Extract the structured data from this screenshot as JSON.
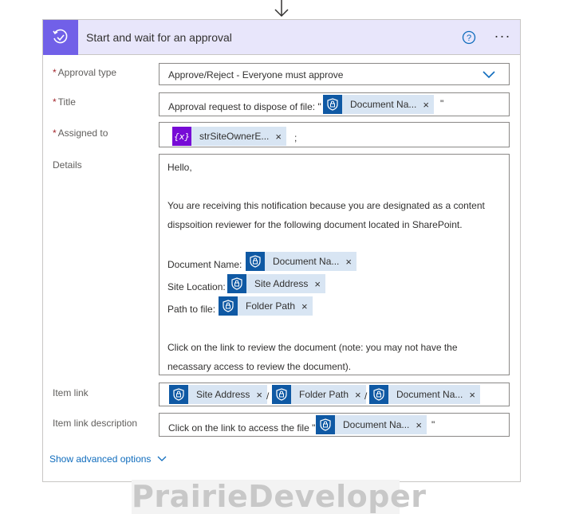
{
  "header": {
    "title": "Start and wait for an approval",
    "more_label": "···"
  },
  "fields": {
    "approval_type": {
      "label": "Approval type",
      "required_mark": "*",
      "value": "Approve/Reject - Everyone must approve"
    },
    "title": {
      "label": "Title",
      "required_mark": "*",
      "prefix": "Approval request to dispose of file: \"",
      "token": "Document Na...",
      "suffix": "\""
    },
    "assigned_to": {
      "label": "Assigned to",
      "required_mark": "*",
      "token_icon_text": "{x}",
      "token": "strSiteOwnerE...",
      "suffix": ";"
    },
    "details": {
      "label": "Details",
      "line1": "Hello,",
      "line2": "You are receiving this notification because you are designated as a content",
      "line3": "dispsoition reviewer for the following document located in SharePoint.",
      "doc_name_label": "Document Name:",
      "doc_name_token": "Document Na...",
      "site_location_label": "Site Location:",
      "site_location_token": "Site Address",
      "path_label": "Path to file:",
      "path_token": "Folder Path",
      "line4": "Click on the link to review the document (note: you may not have the",
      "line5": "necassary access to review the document)."
    },
    "item_link": {
      "label": "Item link",
      "token1": "Site Address",
      "token2": "Folder Path",
      "token3": "Document Na...",
      "separator": "/"
    },
    "item_link_description": {
      "label": "Item link description",
      "prefix": "Click on the link to access the file \"",
      "token": "Document Na...",
      "suffix": "\""
    }
  },
  "advanced_options": "Show advanced options",
  "watermark": "PrairieDeveloper",
  "token_close": "×",
  "colors": {
    "header_bg": "#e8e6fb",
    "header_icon_bg": "#7160e8",
    "token_bg": "#d8e5f3",
    "token_icon_bg": "#0f59a4",
    "variable_icon_bg": "#770bd6",
    "link_color": "#0f6cbd",
    "required_color": "#a4262c"
  }
}
